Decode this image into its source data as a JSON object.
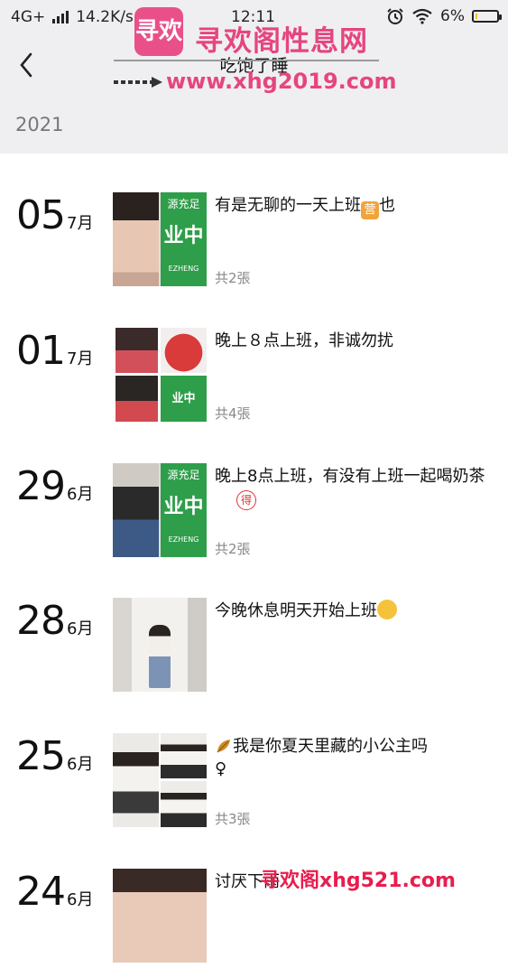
{
  "status_bar": {
    "network": "4G+",
    "speed": "14.2K/s",
    "time": "12:11",
    "battery": "6%",
    "battery_level": 0.06
  },
  "header": {
    "title": "吃饱了睡"
  },
  "section": {
    "year": "2021"
  },
  "entries": [
    {
      "day": "05",
      "month": "7月",
      "caption": "有是无聊的一天上班",
      "caption_tail": "也",
      "emoji": "营",
      "count": "共2張"
    },
    {
      "day": "01",
      "month": "7月",
      "caption": "晚上８点上班，非诚勿扰",
      "count": "共4張"
    },
    {
      "day": "29",
      "month": "6月",
      "caption": "晚上8点上班，有没有上班一起喝奶茶",
      "emoji": "得",
      "count": "共2張"
    },
    {
      "day": "28",
      "month": "6月",
      "caption": "今晚休息明天开始上班",
      "count": ""
    },
    {
      "day": "25",
      "month": "6月",
      "caption": "我是你夏天里藏的小公主吗",
      "caption_tail": "♀",
      "count": "共3張"
    },
    {
      "day": "24",
      "month": "6月",
      "caption": "讨厌下雨",
      "count": ""
    }
  ],
  "thumb_text": {
    "sign_top": "源充足",
    "sign_main": "业中",
    "sign_sub": "EZHENG"
  },
  "watermark": {
    "logo": "寻欢",
    "name": "寻欢阁性息网",
    "url": "www.xhg2019.com",
    "bottom": "寻欢阁xhg521.com"
  },
  "colors": {
    "header_bg": "#efeff1",
    "watermark": "#e6457f",
    "sign_green": "#2f9e4a"
  },
  "icons": [
    "signal-icon",
    "wifi-icon",
    "alarm-icon",
    "battery-icon",
    "back-arrow-icon"
  ]
}
